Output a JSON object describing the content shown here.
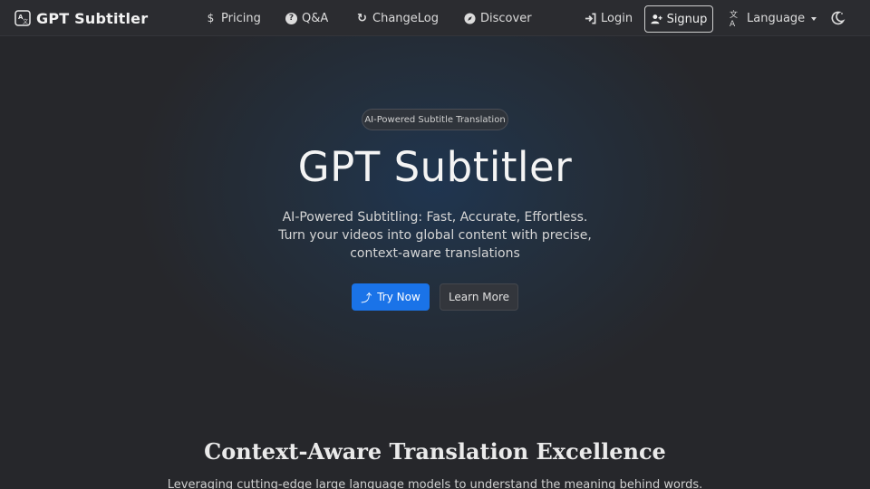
{
  "brand": {
    "name": "GPT Subtitler",
    "icon": "translate-icon"
  },
  "nav": {
    "pricing": "Pricing",
    "qa": "Q&A",
    "changelog": "ChangeLog",
    "discover": "Discover",
    "login": "Login",
    "signup": "Signup",
    "language": "Language"
  },
  "icons": {
    "pricing": "$",
    "qa": "?",
    "changelog": "↻",
    "discover": "compass-icon",
    "login": "sign-in-icon",
    "signup": "user-plus-icon",
    "language": "文A",
    "theme": "moon-icon",
    "try": "⤴"
  },
  "hero": {
    "badge": "AI-Powered Subtitle Translation",
    "title": "GPT Subtitler",
    "subtitle_lines": [
      "AI-Powered Subtitling: Fast, Accurate, Effortless.",
      "Turn your videos into global content with precise,",
      "context-aware translations"
    ],
    "try_label": "Try Now",
    "learn_label": "Learn More"
  },
  "section": {
    "title": "Context-Aware Translation Excellence",
    "description": "Leveraging cutting-edge large language models to understand the meaning behind words."
  },
  "colors": {
    "background": "#26272b",
    "primary": "#1a73e8"
  }
}
